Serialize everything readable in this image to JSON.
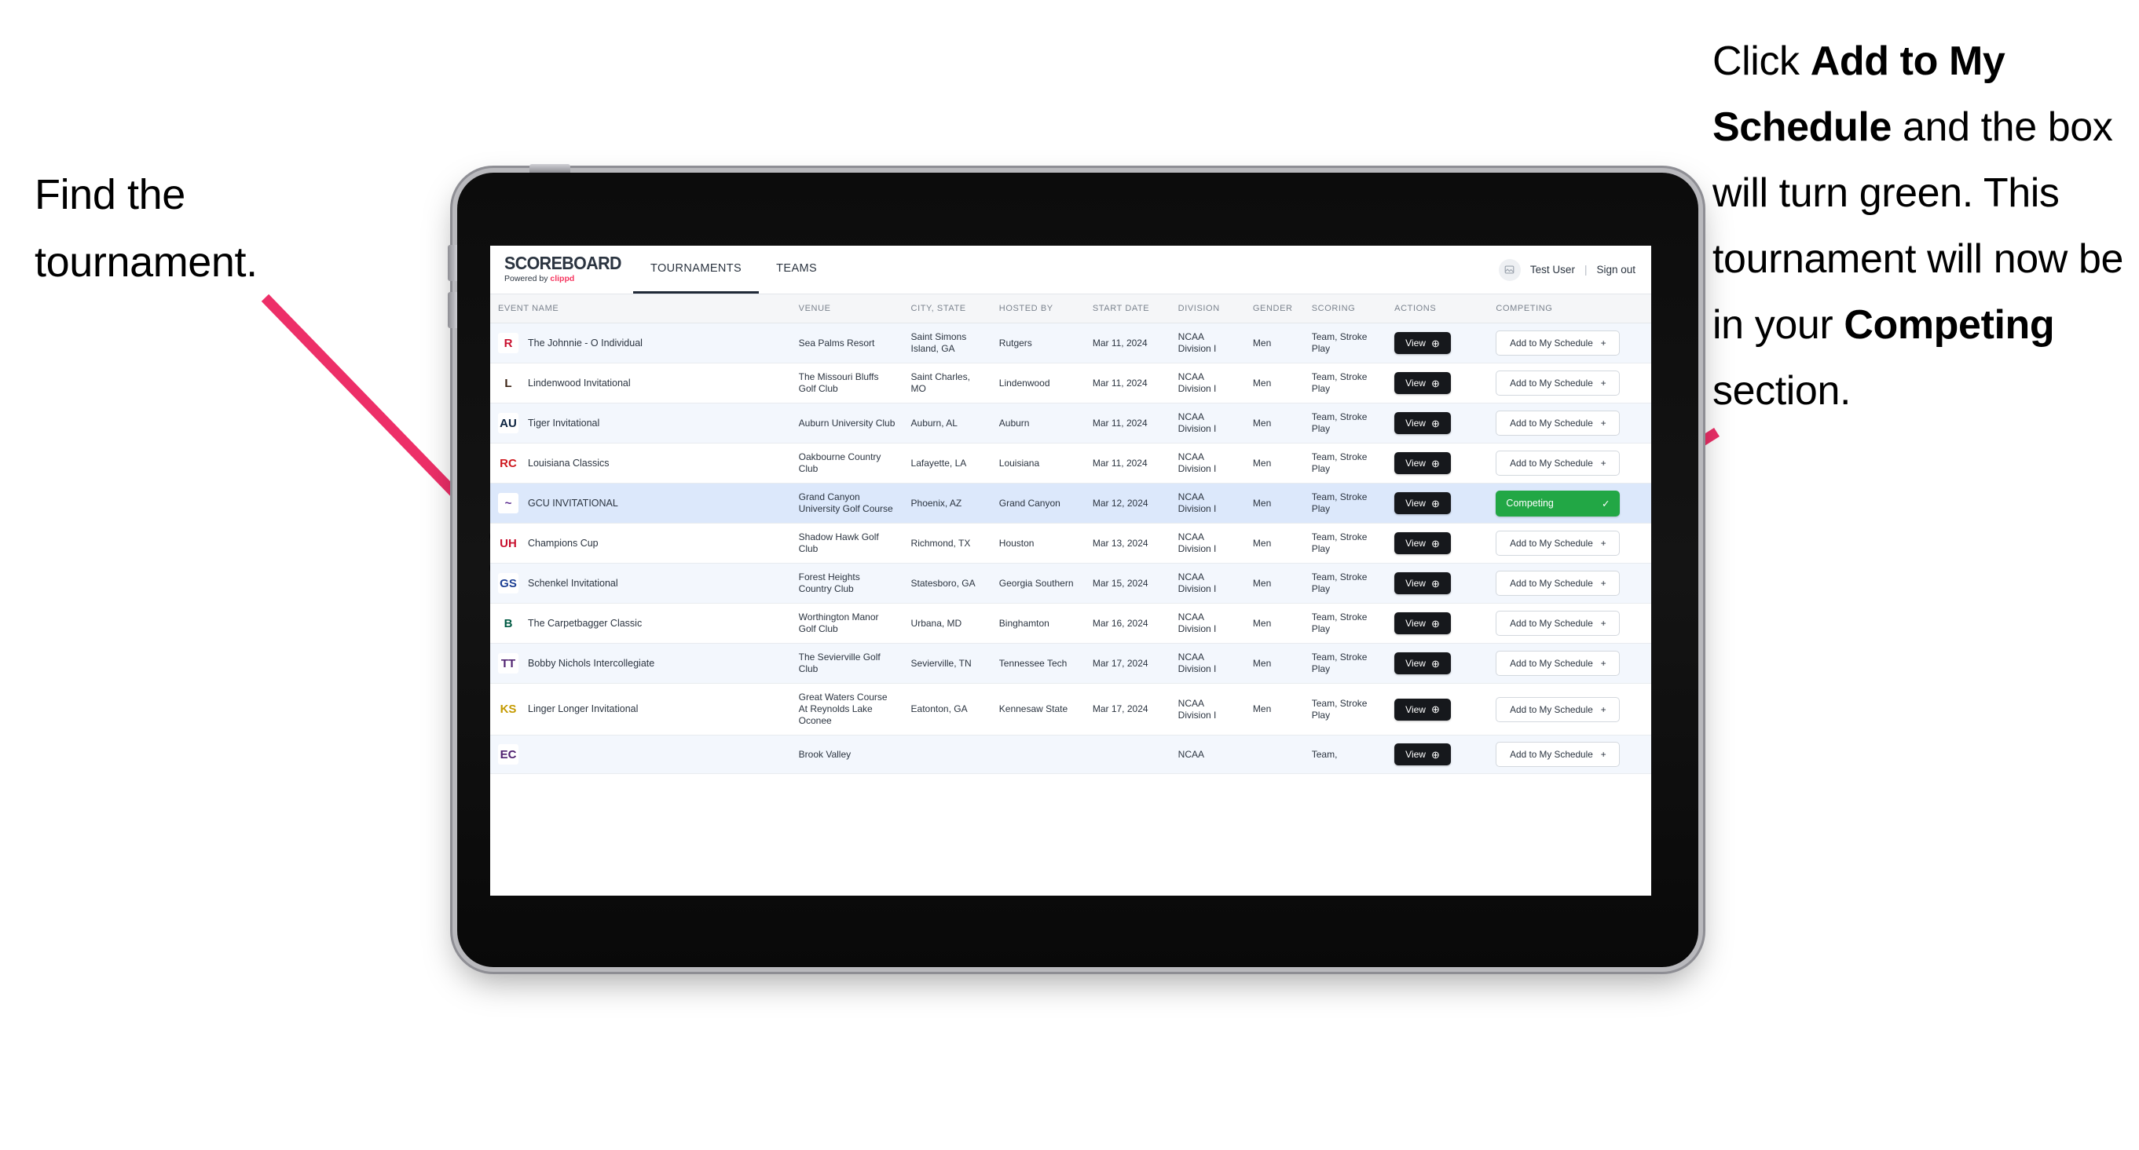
{
  "annotations": {
    "left": "Find the tournament.",
    "right_parts": [
      {
        "text": "Click ",
        "bold": false
      },
      {
        "text": "Add to My Schedule",
        "bold": true
      },
      {
        "text": " and the box will turn green. This tournament will now be in your ",
        "bold": false
      },
      {
        "text": "Competing",
        "bold": true
      },
      {
        "text": " section.",
        "bold": false
      }
    ],
    "arrow_color": "#ed2f68"
  },
  "app": {
    "logo_main": "SCOREBOARD",
    "logo_sub_prefix": "Powered by ",
    "logo_sub_brand": "clippd",
    "tabs": [
      {
        "label": "TOURNAMENTS",
        "active": true
      },
      {
        "label": "TEAMS",
        "active": false
      }
    ],
    "user": {
      "avatar_icon": "user-image-icon",
      "name": "Test User",
      "separator": "|",
      "sign_out": "Sign out"
    }
  },
  "table": {
    "columns": [
      "EVENT NAME",
      "VENUE",
      "CITY, STATE",
      "HOSTED BY",
      "START DATE",
      "DIVISION",
      "GENDER",
      "SCORING",
      "ACTIONS",
      "COMPETING"
    ],
    "view_label": "View",
    "add_label": "Add to My Schedule",
    "add_plus": "+",
    "competing_label": "Competing",
    "competing_check": "✓",
    "competing_color": "#22a745",
    "rows": [
      {
        "logo": {
          "text": "R",
          "bg": "#ffffff",
          "fg": "#c8102e"
        },
        "event": "The Johnnie - O Individual",
        "venue": "Sea Palms Resort",
        "city": "Saint Simons Island, GA",
        "hosted_by": "Rutgers",
        "start_date": "Mar 11, 2024",
        "division": "NCAA Division I",
        "gender": "Men",
        "scoring": "Team, Stroke Play",
        "competing": false
      },
      {
        "logo": {
          "text": "L",
          "bg": "#ffffff",
          "fg": "#3c2415"
        },
        "event": "Lindenwood Invitational",
        "venue": "The Missouri Bluffs Golf Club",
        "city": "Saint Charles, MO",
        "hosted_by": "Lindenwood",
        "start_date": "Mar 11, 2024",
        "division": "NCAA Division I",
        "gender": "Men",
        "scoring": "Team, Stroke Play",
        "competing": false
      },
      {
        "logo": {
          "text": "AU",
          "bg": "#ffffff",
          "fg": "#0c2340"
        },
        "event": "Tiger Invitational",
        "venue": "Auburn University Club",
        "city": "Auburn, AL",
        "hosted_by": "Auburn",
        "start_date": "Mar 11, 2024",
        "division": "NCAA Division I",
        "gender": "Men",
        "scoring": "Team, Stroke Play",
        "competing": false
      },
      {
        "logo": {
          "text": "RC",
          "bg": "#ffffff",
          "fg": "#ce181e"
        },
        "event": "Louisiana Classics",
        "venue": "Oakbourne Country Club",
        "city": "Lafayette, LA",
        "hosted_by": "Louisiana",
        "start_date": "Mar 11, 2024",
        "division": "NCAA Division I",
        "gender": "Men",
        "scoring": "Team, Stroke Play",
        "competing": false
      },
      {
        "logo": {
          "text": "~",
          "bg": "#ffffff",
          "fg": "#5c2d91"
        },
        "event": "GCU INVITATIONAL",
        "venue": "Grand Canyon University Golf Course",
        "city": "Phoenix, AZ",
        "hosted_by": "Grand Canyon",
        "start_date": "Mar 12, 2024",
        "division": "NCAA Division I",
        "gender": "Men",
        "scoring": "Team, Stroke Play",
        "competing": true
      },
      {
        "logo": {
          "text": "UH",
          "bg": "#ffffff",
          "fg": "#c8102e"
        },
        "event": "Champions Cup",
        "venue": "Shadow Hawk Golf Club",
        "city": "Richmond, TX",
        "hosted_by": "Houston",
        "start_date": "Mar 13, 2024",
        "division": "NCAA Division I",
        "gender": "Men",
        "scoring": "Team, Stroke Play",
        "competing": false
      },
      {
        "logo": {
          "text": "GS",
          "bg": "#ffffff",
          "fg": "#1c3f94"
        },
        "event": "Schenkel Invitational",
        "venue": "Forest Heights Country Club",
        "city": "Statesboro, GA",
        "hosted_by": "Georgia Southern",
        "start_date": "Mar 15, 2024",
        "division": "NCAA Division I",
        "gender": "Men",
        "scoring": "Team, Stroke Play",
        "competing": false
      },
      {
        "logo": {
          "text": "B",
          "bg": "#ffffff",
          "fg": "#005a43"
        },
        "event": "The Carpetbagger Classic",
        "venue": "Worthington Manor Golf Club",
        "city": "Urbana, MD",
        "hosted_by": "Binghamton",
        "start_date": "Mar 16, 2024",
        "division": "NCAA Division I",
        "gender": "Men",
        "scoring": "Team, Stroke Play",
        "competing": false
      },
      {
        "logo": {
          "text": "TT",
          "bg": "#ffffff",
          "fg": "#4f2170"
        },
        "event": "Bobby Nichols Intercollegiate",
        "venue": "The Sevierville Golf Club",
        "city": "Sevierville, TN",
        "hosted_by": "Tennessee Tech",
        "start_date": "Mar 17, 2024",
        "division": "NCAA Division I",
        "gender": "Men",
        "scoring": "Team, Stroke Play",
        "competing": false
      },
      {
        "logo": {
          "text": "KS",
          "bg": "#ffffff",
          "fg": "#c49a00"
        },
        "event": "Linger Longer Invitational",
        "venue": "Great Waters Course At Reynolds Lake Oconee",
        "city": "Eatonton, GA",
        "hosted_by": "Kennesaw State",
        "start_date": "Mar 17, 2024",
        "division": "NCAA Division I",
        "gender": "Men",
        "scoring": "Team, Stroke Play",
        "competing": false
      },
      {
        "logo": {
          "text": "EC",
          "bg": "#ffffff",
          "fg": "#4f2170"
        },
        "event": "",
        "venue": "Brook Valley",
        "city": "",
        "hosted_by": "",
        "start_date": "",
        "division": "NCAA",
        "gender": "",
        "scoring": "Team,",
        "competing": false,
        "partial": true
      }
    ]
  }
}
